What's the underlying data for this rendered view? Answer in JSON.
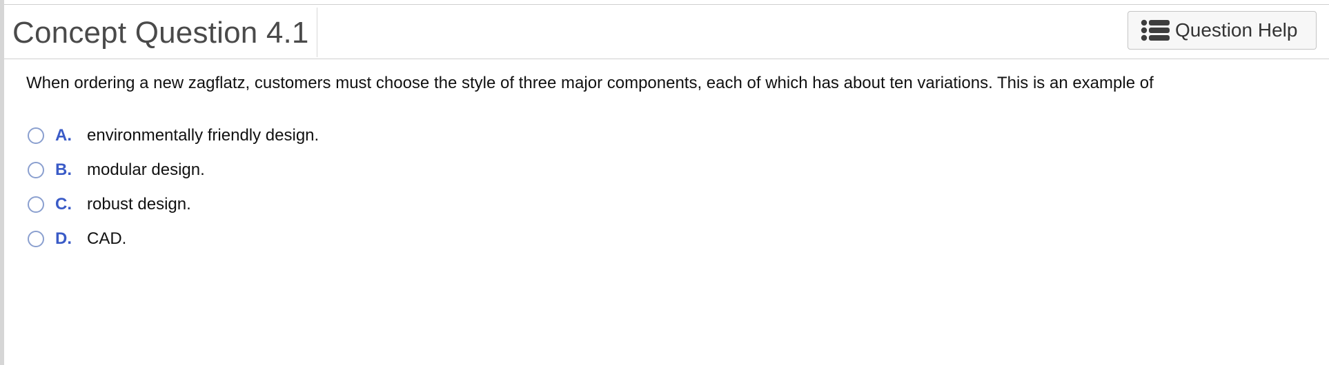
{
  "header": {
    "title": "Concept Question 4.1",
    "help_button": {
      "label": "Question Help",
      "icon": "list-icon"
    }
  },
  "question": {
    "text": "When ordering a new zagflatz, customers must choose the style of three major components, each of which has about ten variations. This is an example of"
  },
  "options": [
    {
      "letter": "A.",
      "text": "environmentally friendly design.",
      "selected": false
    },
    {
      "letter": "B.",
      "text": "modular design.",
      "selected": false
    },
    {
      "letter": "C.",
      "text": "robust design.",
      "selected": false
    },
    {
      "letter": "D.",
      "text": "CAD.",
      "selected": false
    }
  ],
  "colors": {
    "title": "#4a4a4a",
    "option_letter": "#3a5bc7",
    "radio_border": "#8a9fcf",
    "divider": "#cfcfcf"
  }
}
